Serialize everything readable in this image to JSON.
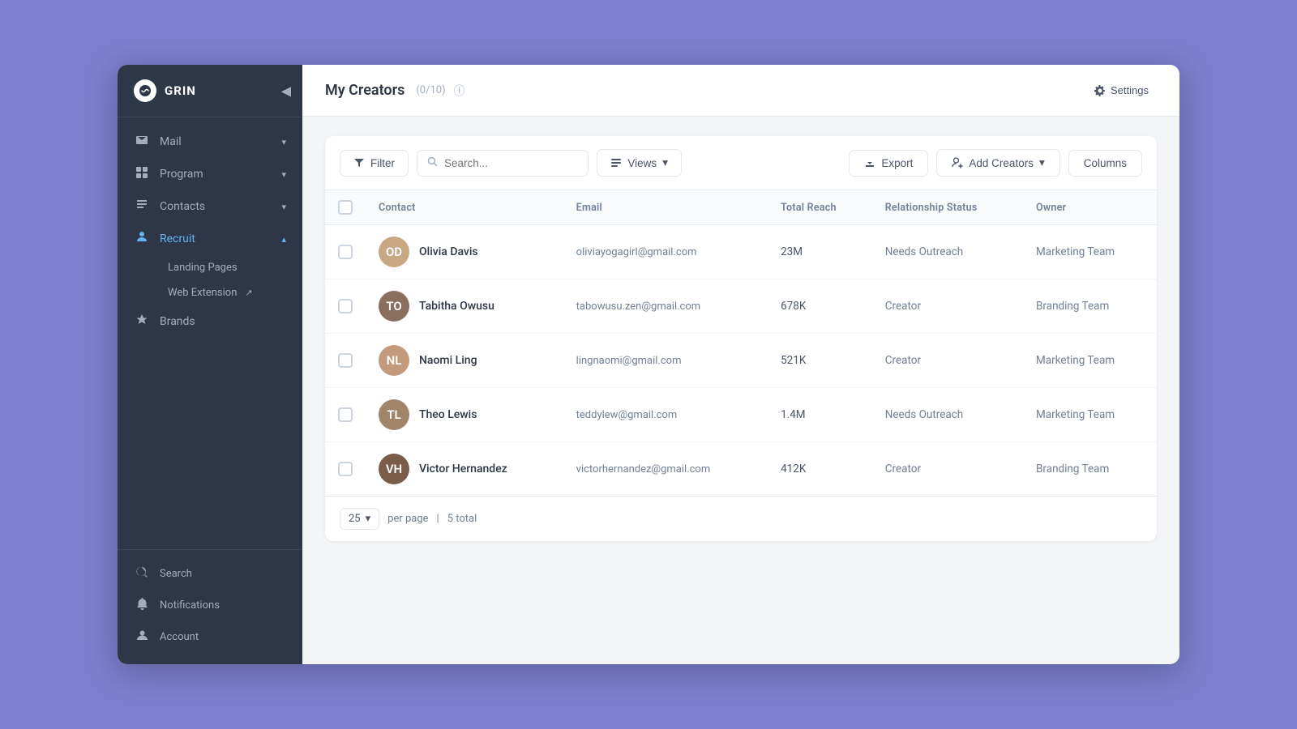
{
  "app": {
    "name": "GRIN"
  },
  "sidebar": {
    "collapse_icon": "◀",
    "items": [
      {
        "id": "mail",
        "label": "Mail",
        "icon": "✉",
        "has_arrow": true
      },
      {
        "id": "program",
        "label": "Program",
        "icon": "⊞",
        "has_arrow": true
      },
      {
        "id": "contacts",
        "label": "Contacts",
        "icon": "☰",
        "has_arrow": true
      },
      {
        "id": "recruit",
        "label": "Recruit",
        "icon": "⚡",
        "has_arrow": true,
        "active": true
      }
    ],
    "recruit_sub": [
      {
        "id": "landing-pages",
        "label": "Landing Pages",
        "active": false
      },
      {
        "id": "web-extension",
        "label": "Web Extension",
        "has_ext": true,
        "active": false
      }
    ],
    "bottom_items": [
      {
        "id": "brands",
        "label": "Brands",
        "icon": "☆"
      }
    ],
    "footer_items": [
      {
        "id": "search",
        "label": "Search",
        "icon": "🔍"
      },
      {
        "id": "notifications",
        "label": "Notifications",
        "icon": "🔔"
      },
      {
        "id": "account",
        "label": "Account",
        "icon": "👤"
      }
    ]
  },
  "header": {
    "title": "My Creators",
    "count": "(0/10)",
    "settings_label": "Settings"
  },
  "toolbar": {
    "filter_label": "Filter",
    "search_placeholder": "Search...",
    "views_label": "Views",
    "export_label": "Export",
    "add_creators_label": "Add Creators",
    "columns_label": "Columns"
  },
  "table": {
    "columns": [
      {
        "id": "contact",
        "label": "Contact"
      },
      {
        "id": "email",
        "label": "Email"
      },
      {
        "id": "total_reach",
        "label": "Total Reach"
      },
      {
        "id": "relationship_status",
        "label": "Relationship Status"
      },
      {
        "id": "owner",
        "label": "Owner"
      }
    ],
    "rows": [
      {
        "id": 1,
        "name": "Olivia Davis",
        "email": "oliviayogagirl@gmail.com",
        "total_reach": "23M",
        "relationship_status": "Needs Outreach",
        "owner": "Marketing Team",
        "avatar_color": "#c8a882",
        "avatar_initials": "OD"
      },
      {
        "id": 2,
        "name": "Tabitha Owusu",
        "email": "tabowusu.zen@gmail.com",
        "total_reach": "678K",
        "relationship_status": "Creator",
        "owner": "Branding Team",
        "avatar_color": "#8b6f5e",
        "avatar_initials": "TO"
      },
      {
        "id": 3,
        "name": "Naomi Ling",
        "email": "lingnaomi@gmail.com",
        "total_reach": "521K",
        "relationship_status": "Creator",
        "owner": "Marketing Team",
        "avatar_color": "#c49a7c",
        "avatar_initials": "NL"
      },
      {
        "id": 4,
        "name": "Theo Lewis",
        "email": "teddylew@gmail.com",
        "total_reach": "1.4M",
        "relationship_status": "Needs Outreach",
        "owner": "Marketing Team",
        "avatar_color": "#a0856a",
        "avatar_initials": "TL"
      },
      {
        "id": 5,
        "name": "Victor Hernandez",
        "email": "victorhernandez@gmail.com",
        "total_reach": "412K",
        "relationship_status": "Creator",
        "owner": "Branding Team",
        "avatar_color": "#7a5c4a",
        "avatar_initials": "VH"
      }
    ]
  },
  "pagination": {
    "per_page": "25",
    "per_page_label": "per page",
    "total_label": "5 total"
  }
}
